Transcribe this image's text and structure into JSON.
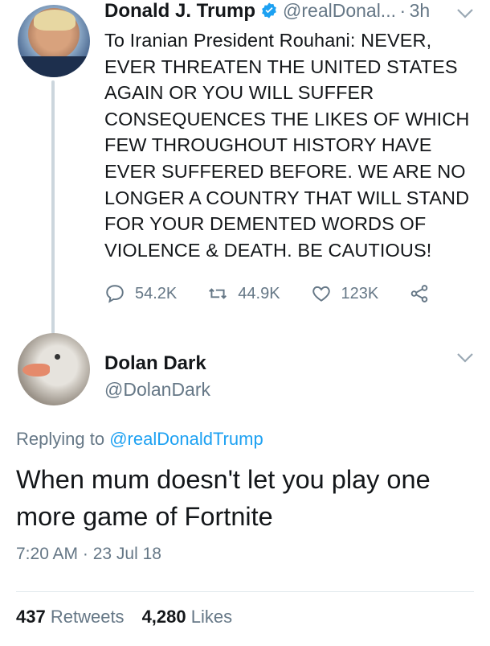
{
  "parent_tweet": {
    "author_name": "Donald J. Trump",
    "handle": "@realDonal...",
    "separator": "·",
    "time_ago": "3h",
    "text": "To Iranian President Rouhani: NEVER,\nEVER THREATEN THE UNITED STATES\nAGAIN OR YOU WILL SUFFER\nCONSEQUENCES THE LIKES OF WHICH\nFEW THROUGHOUT HISTORY HAVE\nEVER SUFFERED BEFORE. WE ARE NO\nLONGER A COUNTRY THAT WILL STAND\nFOR YOUR DEMENTED WORDS OF\nVIOLENCE & DEATH. BE CAUTIOUS!",
    "replies": "54.2K",
    "retweets": "44.9K",
    "likes": "123K",
    "verified": true,
    "avatar_icon": "profile-photo"
  },
  "reply_tweet": {
    "author_name": "Dolan Dark",
    "handle": "@DolanDark",
    "replying_to_prefix": "Replying to",
    "replying_to_handle": "@realDonaldTrump",
    "text": "When mum doesn't let you play one more game of Fortnite",
    "timestamp": "7:20 AM · 23 Jul 18",
    "retweet_count": "437",
    "retweet_label": "Retweets",
    "like_count": "4,280",
    "like_label": "Likes",
    "avatar_icon": "goose-photo"
  },
  "colors": {
    "text": "#14171a",
    "secondary": "#657786",
    "link": "#1da1f2",
    "divider": "#e1e8ed",
    "thread_line": "#ccd6dd"
  }
}
